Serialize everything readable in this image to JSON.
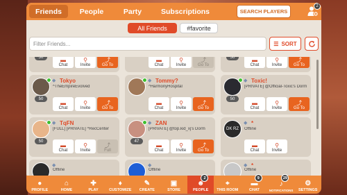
{
  "top_nav": {
    "tabs": [
      {
        "label": "Friends"
      },
      {
        "label": "People"
      },
      {
        "label": "Party"
      },
      {
        "label": "Subscriptions"
      }
    ],
    "search_label": "SEARCH PLAYERS",
    "add_friend_badge": "2"
  },
  "filters": {
    "all_label": "All Friends",
    "favorite_label": "#favorite"
  },
  "search": {
    "placeholder": "Filter Friends...",
    "sort_label": "SORT"
  },
  "actions": {
    "chat": "Chat",
    "invite": "Invite",
    "goto": "Go To"
  },
  "partial_row": [
    {
      "level": "50"
    },
    {
      "level": ""
    },
    {
      "level": "50"
    }
  ],
  "friends": [
    {
      "name": "Tokyo",
      "status": "^TheEmpireEvolved",
      "level": "50",
      "goto_enabled": true
    },
    {
      "name": "Tommy?",
      "status": "^HarmonyHospital",
      "level": "",
      "goto_enabled": true
    },
    {
      "name": "Toxic!",
      "status": "[PRIVATE] @Official-Toxic's Dorm",
      "level": "50",
      "goto_enabled": true
    },
    {
      "name": "TqFN",
      "status": "[FULL] [PRIVATE] ^RecCenter",
      "level": "50",
      "goto_enabled": false
    },
    {
      "name": "ZAN",
      "status": "[PRIVATE] @top.kid_xj's Dorm",
      "level": "47",
      "goto_enabled": true
    },
    {
      "name": "*",
      "status": "Offline",
      "level": "",
      "goto_enabled": false,
      "avatar_text": "DK RZ"
    },
    {
      "name": "",
      "status": "Offline",
      "level": ""
    },
    {
      "name": "",
      "status": "Offline",
      "level": ""
    },
    {
      "name": "*",
      "status": "Offline",
      "level": ""
    }
  ],
  "bottom_nav": [
    {
      "label": "PROFILE"
    },
    {
      "label": "HOME"
    },
    {
      "label": "PLAY"
    },
    {
      "label": "CUSTOMIZE"
    },
    {
      "label": "CREATE"
    },
    {
      "label": "STORE"
    },
    {
      "label": "PEOPLE",
      "badge": "2"
    },
    {
      "label": "THIS ROOM"
    },
    {
      "label": "CHAT",
      "badge": "9"
    },
    {
      "label": "NOTIFICATIONS",
      "badge": "29"
    },
    {
      "label": "SETTINGS"
    }
  ],
  "colors": {
    "accent": "#ef8a3a",
    "active": "#e04a28",
    "online": "#3fbf2f"
  }
}
